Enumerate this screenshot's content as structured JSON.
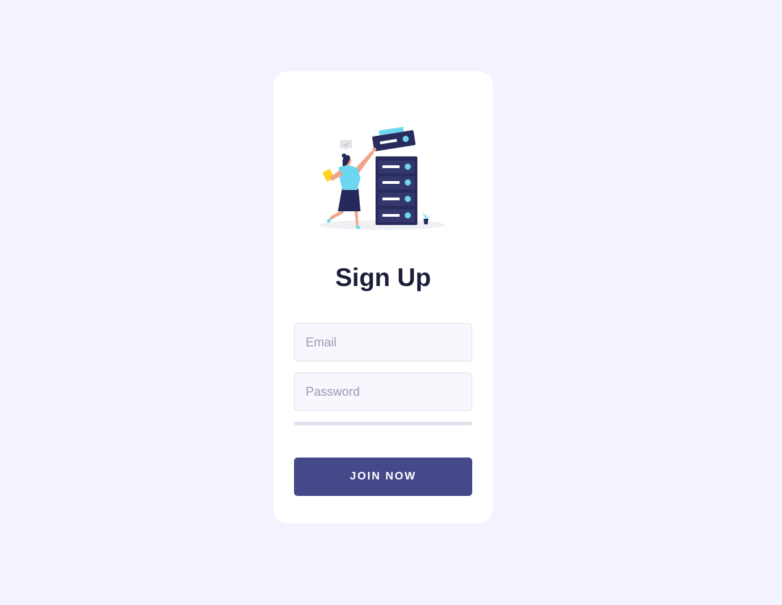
{
  "signup": {
    "title": "Sign Up",
    "email_placeholder": "Email",
    "email_value": "",
    "password_placeholder": "Password",
    "password_value": "",
    "password_strength": 0,
    "submit_label": "JOIN NOW"
  },
  "colors": {
    "page_background": "#f2f3fe",
    "card_background": "#ffffff",
    "accent": "#45498a",
    "server_dark": "#282b5c",
    "server_light": "#6dd6f0",
    "figure_skirt": "#25285a",
    "figure_top": "#6dd6f0",
    "figure_skin": "#f2a48a",
    "folder": "#ffd21f"
  },
  "illustration": {
    "icon": "server-woman-illustration"
  }
}
